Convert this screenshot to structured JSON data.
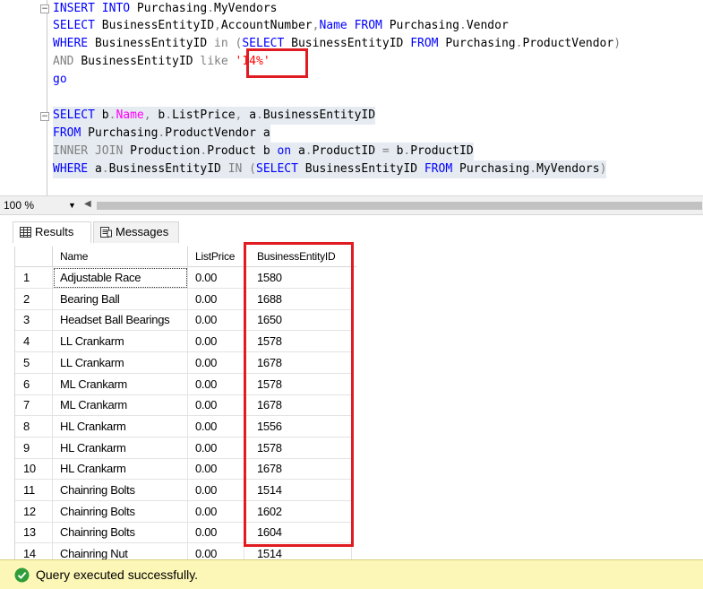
{
  "editor": {
    "lines": [
      [
        {
          "t": "INSERT INTO ",
          "c": "kw"
        },
        {
          "t": "Purchasing",
          "c": ""
        },
        {
          "t": ".",
          "c": "gray"
        },
        {
          "t": "MyVendors",
          "c": ""
        }
      ],
      [
        {
          "t": "SELECT ",
          "c": "kw"
        },
        {
          "t": "BusinessEntityID",
          "c": ""
        },
        {
          "t": ",",
          "c": "gray"
        },
        {
          "t": "AccountNumber",
          "c": ""
        },
        {
          "t": ",",
          "c": "gray"
        },
        {
          "t": "Name ",
          "c": "kw"
        },
        {
          "t": "FROM ",
          "c": "kw"
        },
        {
          "t": "Purchasing",
          "c": ""
        },
        {
          "t": ".",
          "c": "gray"
        },
        {
          "t": "Vendor",
          "c": ""
        }
      ],
      [
        {
          "t": "WHERE ",
          "c": "kw"
        },
        {
          "t": "BusinessEntityID ",
          "c": ""
        },
        {
          "t": "in ",
          "c": "gray"
        },
        {
          "t": "(",
          "c": "gray"
        },
        {
          "t": "SELECT ",
          "c": "kw"
        },
        {
          "t": "BusinessEntityID ",
          "c": ""
        },
        {
          "t": "FROM ",
          "c": "kw"
        },
        {
          "t": "Purchasing",
          "c": ""
        },
        {
          "t": ".",
          "c": "gray"
        },
        {
          "t": "ProductVendor",
          "c": ""
        },
        {
          "t": ")",
          "c": "gray"
        }
      ],
      [
        {
          "t": "AND ",
          "c": "gray"
        },
        {
          "t": "BusinessEntityID ",
          "c": ""
        },
        {
          "t": "like ",
          "c": "gray"
        },
        {
          "t": "'14%'",
          "c": "red"
        }
      ],
      [
        {
          "t": "go",
          "c": "kw"
        }
      ],
      [],
      [
        {
          "t": "SELECT ",
          "c": "kw"
        },
        {
          "t": "b",
          "c": ""
        },
        {
          "t": ".",
          "c": "gray"
        },
        {
          "t": "Name",
          "c": "pink"
        },
        {
          "t": ", ",
          "c": "gray"
        },
        {
          "t": "b",
          "c": ""
        },
        {
          "t": ".",
          "c": "gray"
        },
        {
          "t": "ListPrice",
          "c": ""
        },
        {
          "t": ", ",
          "c": "gray"
        },
        {
          "t": "a",
          "c": ""
        },
        {
          "t": ".",
          "c": "gray"
        },
        {
          "t": "BusinessEntityID",
          "c": ""
        }
      ],
      [
        {
          "t": "FROM ",
          "c": "kw"
        },
        {
          "t": "Purchasing",
          "c": ""
        },
        {
          "t": ".",
          "c": "gray"
        },
        {
          "t": "ProductVendor ",
          "c": ""
        },
        {
          "t": "a",
          "c": ""
        }
      ],
      [
        {
          "t": "INNER JOIN ",
          "c": "gray"
        },
        {
          "t": "Production",
          "c": ""
        },
        {
          "t": ".",
          "c": "gray"
        },
        {
          "t": "Product ",
          "c": ""
        },
        {
          "t": "b ",
          "c": ""
        },
        {
          "t": "on ",
          "c": "kw"
        },
        {
          "t": "a",
          "c": ""
        },
        {
          "t": ".",
          "c": "gray"
        },
        {
          "t": "ProductID ",
          "c": ""
        },
        {
          "t": "= ",
          "c": "gray"
        },
        {
          "t": "b",
          "c": ""
        },
        {
          "t": ".",
          "c": "gray"
        },
        {
          "t": "ProductID",
          "c": ""
        }
      ],
      [
        {
          "t": "WHERE ",
          "c": "kw"
        },
        {
          "t": "a",
          "c": ""
        },
        {
          "t": ".",
          "c": "gray"
        },
        {
          "t": "BusinessEntityID ",
          "c": ""
        },
        {
          "t": "IN ",
          "c": "gray"
        },
        {
          "t": "(",
          "c": "gray"
        },
        {
          "t": "SELECT ",
          "c": "kw"
        },
        {
          "t": "BusinessEntityID ",
          "c": ""
        },
        {
          "t": "FROM ",
          "c": "kw"
        },
        {
          "t": "Purchasing",
          "c": ""
        },
        {
          "t": ".",
          "c": "gray"
        },
        {
          "t": "MyVendors",
          "c": ""
        },
        {
          "t": ")",
          "c": "gray"
        }
      ]
    ],
    "fold_symbol": "−"
  },
  "zoom": {
    "value": "100 %",
    "arrow": "▼",
    "scroll_left": "◀"
  },
  "tabs": {
    "results": "Results",
    "messages": "Messages"
  },
  "grid": {
    "columns": [
      "",
      "Name",
      "ListPrice",
      "BusinessEntityID"
    ],
    "rows": [
      [
        "1",
        "Adjustable Race",
        "0.00",
        "1580"
      ],
      [
        "2",
        "Bearing Ball",
        "0.00",
        "1688"
      ],
      [
        "3",
        "Headset Ball Bearings",
        "0.00",
        "1650"
      ],
      [
        "4",
        "LL Crankarm",
        "0.00",
        "1578"
      ],
      [
        "5",
        "LL Crankarm",
        "0.00",
        "1678"
      ],
      [
        "6",
        "ML Crankarm",
        "0.00",
        "1578"
      ],
      [
        "7",
        "ML Crankarm",
        "0.00",
        "1678"
      ],
      [
        "8",
        "HL Crankarm",
        "0.00",
        "1556"
      ],
      [
        "9",
        "HL Crankarm",
        "0.00",
        "1578"
      ],
      [
        "10",
        "HL Crankarm",
        "0.00",
        "1678"
      ],
      [
        "11",
        "Chainring Bolts",
        "0.00",
        "1514"
      ],
      [
        "12",
        "Chainring Bolts",
        "0.00",
        "1602"
      ],
      [
        "13",
        "Chainring Bolts",
        "0.00",
        "1604"
      ],
      [
        "14",
        "Chainring Nut",
        "0.00",
        "1514"
      ]
    ]
  },
  "status": {
    "text": "Query executed successfully.",
    "check": "✓"
  },
  "colors": {
    "highlight": "#e01b22",
    "keyword": "#0000ff",
    "status_bg": "#fcf7b6"
  }
}
